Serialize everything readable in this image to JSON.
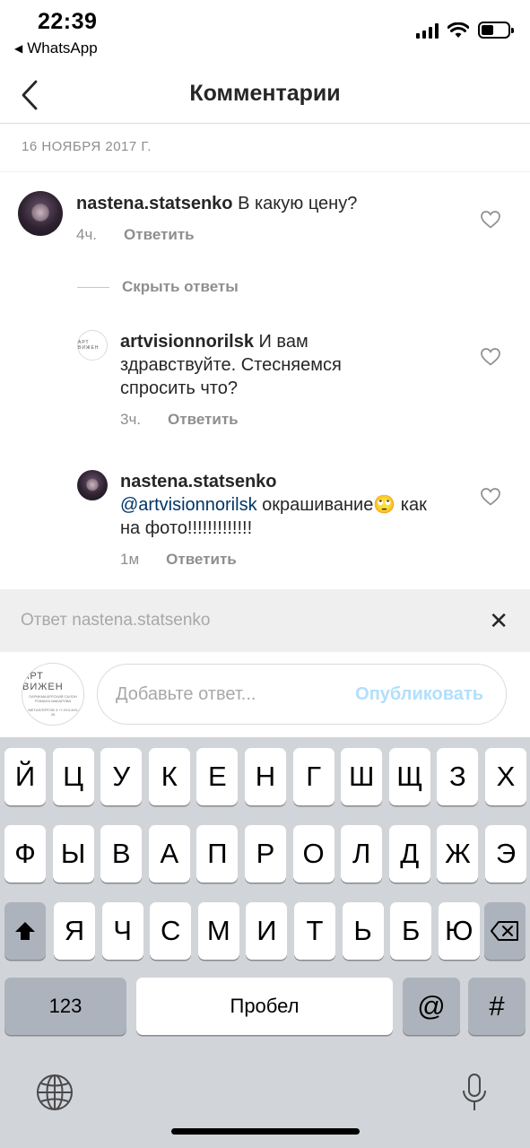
{
  "status": {
    "time": "22:39",
    "back_app": "WhatsApp",
    "battery_level": 0.45
  },
  "header": {
    "title": "Комментарии"
  },
  "post": {
    "date": "16 НОЯБРЯ 2017 Г."
  },
  "comments": [
    {
      "user": "nastena.statsenko",
      "text": " В какую цену?",
      "time": "4ч.",
      "reply": "Ответить"
    }
  ],
  "hide_replies": "Скрыть ответы",
  "replies": [
    {
      "user": "artvisionnorilsk",
      "text": " И вам здравствуйте. Стесняемся спросить что?",
      "time": "3ч.",
      "reply": "Ответить"
    },
    {
      "user": "nastena.statsenko",
      "mention": "@artvisionnorilsk",
      "text": " окрашивание🙄 как на фото!!!!!!!!!!!!!",
      "time": "1м",
      "reply": "Ответить"
    }
  ],
  "brand_avatar": {
    "name": "АРТ ВИЖЕН",
    "sub": "ПАРИКМАХЕРСКИЙ САЛОН РОМАНА МАКАРОВА",
    "addr": "ул. МЕТАЛЛУРГОВ 3\n+7-913-493-49-26"
  },
  "reply_banner": {
    "label": "Ответ nastena.statsenko",
    "close": "✕"
  },
  "compose": {
    "placeholder": "Добавьте ответ...",
    "publish": "Опубликовать"
  },
  "keyboard": {
    "row1": [
      "Й",
      "Ц",
      "У",
      "К",
      "Е",
      "Н",
      "Г",
      "Ш",
      "Щ",
      "З",
      "Х"
    ],
    "row2": [
      "Ф",
      "Ы",
      "В",
      "А",
      "П",
      "Р",
      "О",
      "Л",
      "Д",
      "Ж",
      "Э"
    ],
    "row3": [
      "Я",
      "Ч",
      "С",
      "М",
      "И",
      "Т",
      "Ь",
      "Б",
      "Ю"
    ],
    "numbers": "123",
    "space": "Пробел",
    "at": "@",
    "hash": "#"
  },
  "icons": [
    "back-chevron-icon",
    "signal-icon",
    "wifi-icon",
    "battery-icon",
    "heart-icon",
    "shift-icon",
    "backspace-icon",
    "globe-icon",
    "microphone-icon",
    "close-icon"
  ]
}
